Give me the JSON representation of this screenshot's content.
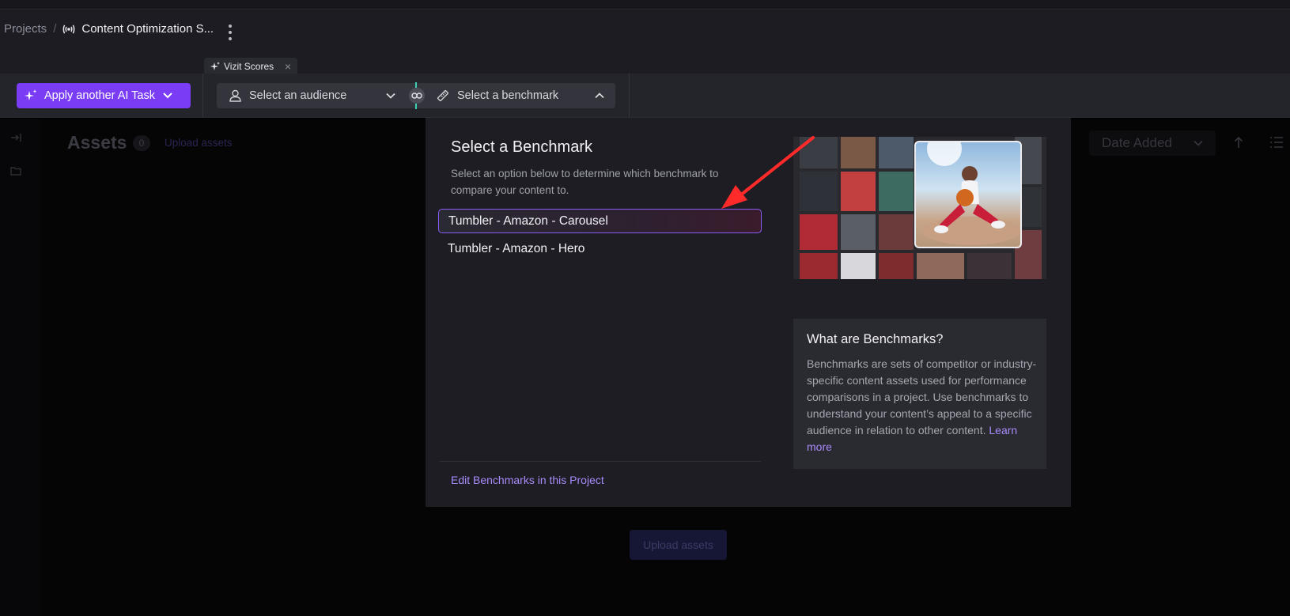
{
  "breadcrumb": {
    "projects": "Projects",
    "separator": "/",
    "current": "Content Optimization S..."
  },
  "tab": {
    "label": "Vizit Scores",
    "close": "×"
  },
  "toolbar": {
    "ai_task_label": "Apply another AI Task",
    "audience_placeholder": "Select an audience",
    "benchmark_placeholder": "Select a benchmark"
  },
  "background": {
    "assets_title": "Assets",
    "assets_count": "0",
    "upload_link": "Upload assets",
    "sort_select": "Date Added",
    "upload_button": "Upload assets"
  },
  "benchmark_panel": {
    "title": "Select a Benchmark",
    "description": "Select an option below to determine which benchmark to compare your content to.",
    "options": [
      "Tumbler - Amazon - Carousel",
      "Tumbler - Amazon - Hero"
    ],
    "selected_option": "Tumbler - Amazon - Carousel",
    "edit_link": "Edit Benchmarks in this Project",
    "info_title": "What are Benchmarks?",
    "info_text": "Benchmarks are sets of competitor or industry-specific content assets used for performance comparisons in a project. Use benchmarks to understand your content’s appeal to a specific audience in relation to other content.",
    "learn_more": "Learn more"
  },
  "colors": {
    "accent": "#7b3cf6",
    "link": "#a78bfa",
    "annotation_arrow": "#ff2a2a",
    "link_connector": "#3fd1b8"
  }
}
